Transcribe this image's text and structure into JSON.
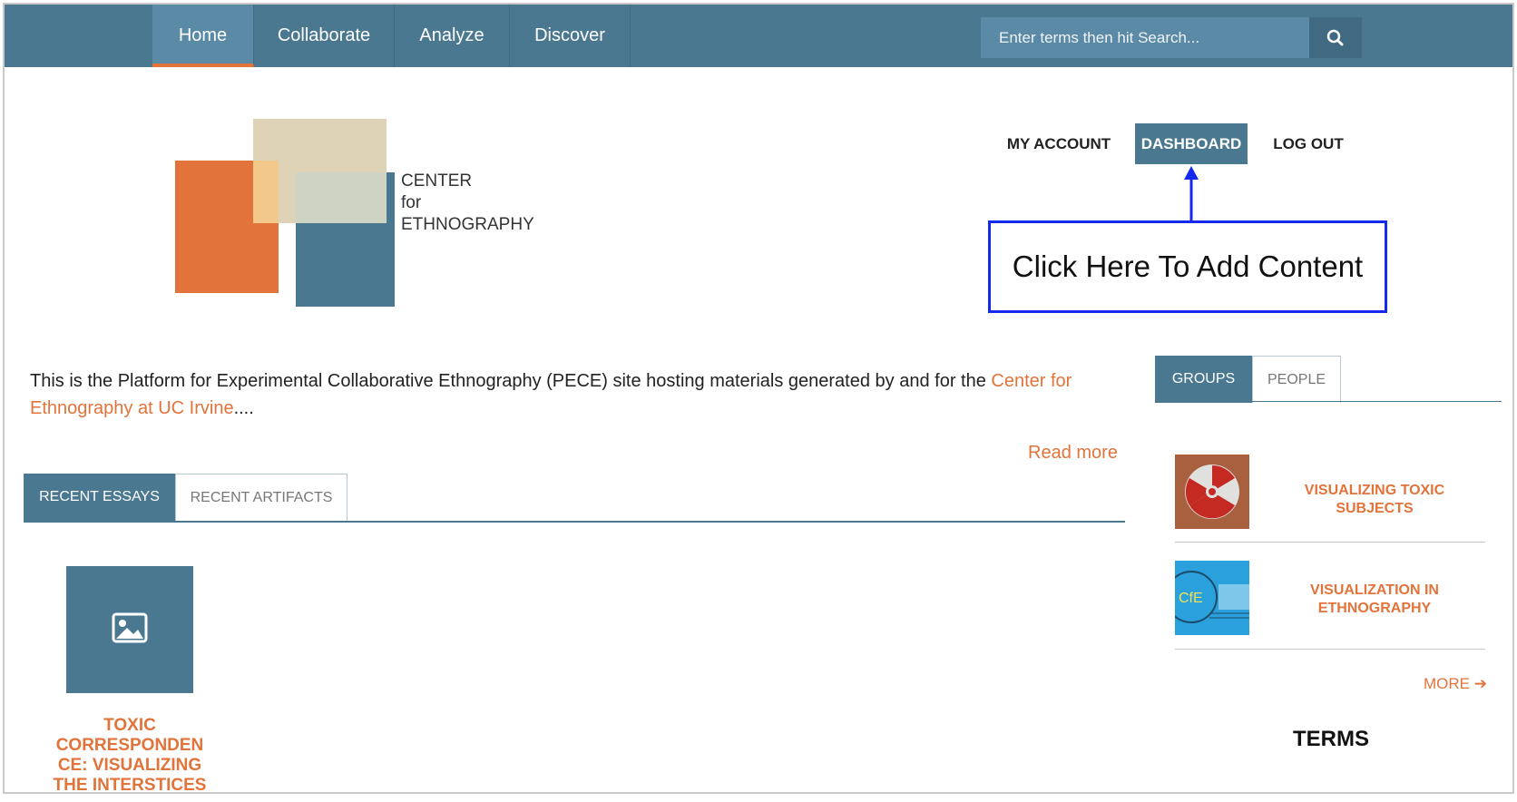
{
  "nav": {
    "items": [
      {
        "label": "Home",
        "active": true
      },
      {
        "label": "Collaborate",
        "active": false
      },
      {
        "label": "Analyze",
        "active": false
      },
      {
        "label": "Discover",
        "active": false
      }
    ],
    "search_placeholder": "Enter terms then hit Search...",
    "search_icon": "search-icon"
  },
  "logo": {
    "line1": "CENTER",
    "line2": "for",
    "line3": "ETHNOGRAPHY"
  },
  "account": {
    "my_account": "MY ACCOUNT",
    "dashboard": "DASHBOARD",
    "logout": "LOG OUT"
  },
  "callout": {
    "text": "Click Here To Add Content"
  },
  "intro": {
    "text": "This is the Platform for Experimental Collaborative Ethnography (PECE) site hosting materials generated by and for the ",
    "link": "Center for Ethnography at UC Irvine",
    "ellipsis": "....",
    "read_more": "Read more"
  },
  "content_tabs": {
    "recent_essays": "RECENT ESSAYS",
    "recent_artifacts": "RECENT ARTIFACTS"
  },
  "essay": {
    "title": "TOXIC CORRESPONDEN CE: VISUALIZING THE INTERSTICES",
    "thumb_icon": "image-icon"
  },
  "sidebar": {
    "tabs": {
      "groups": "GROUPS",
      "people": "PEOPLE"
    },
    "groups": [
      {
        "title": "VISUALIZING TOXIC SUBJECTS"
      },
      {
        "title": "VISUALIZATION IN ETHNOGRAPHY"
      }
    ],
    "more": "MORE",
    "terms": "TERMS"
  },
  "colors": {
    "nav": "#4a7891",
    "accent": "#e2733a",
    "callout_border": "#1428ee"
  }
}
